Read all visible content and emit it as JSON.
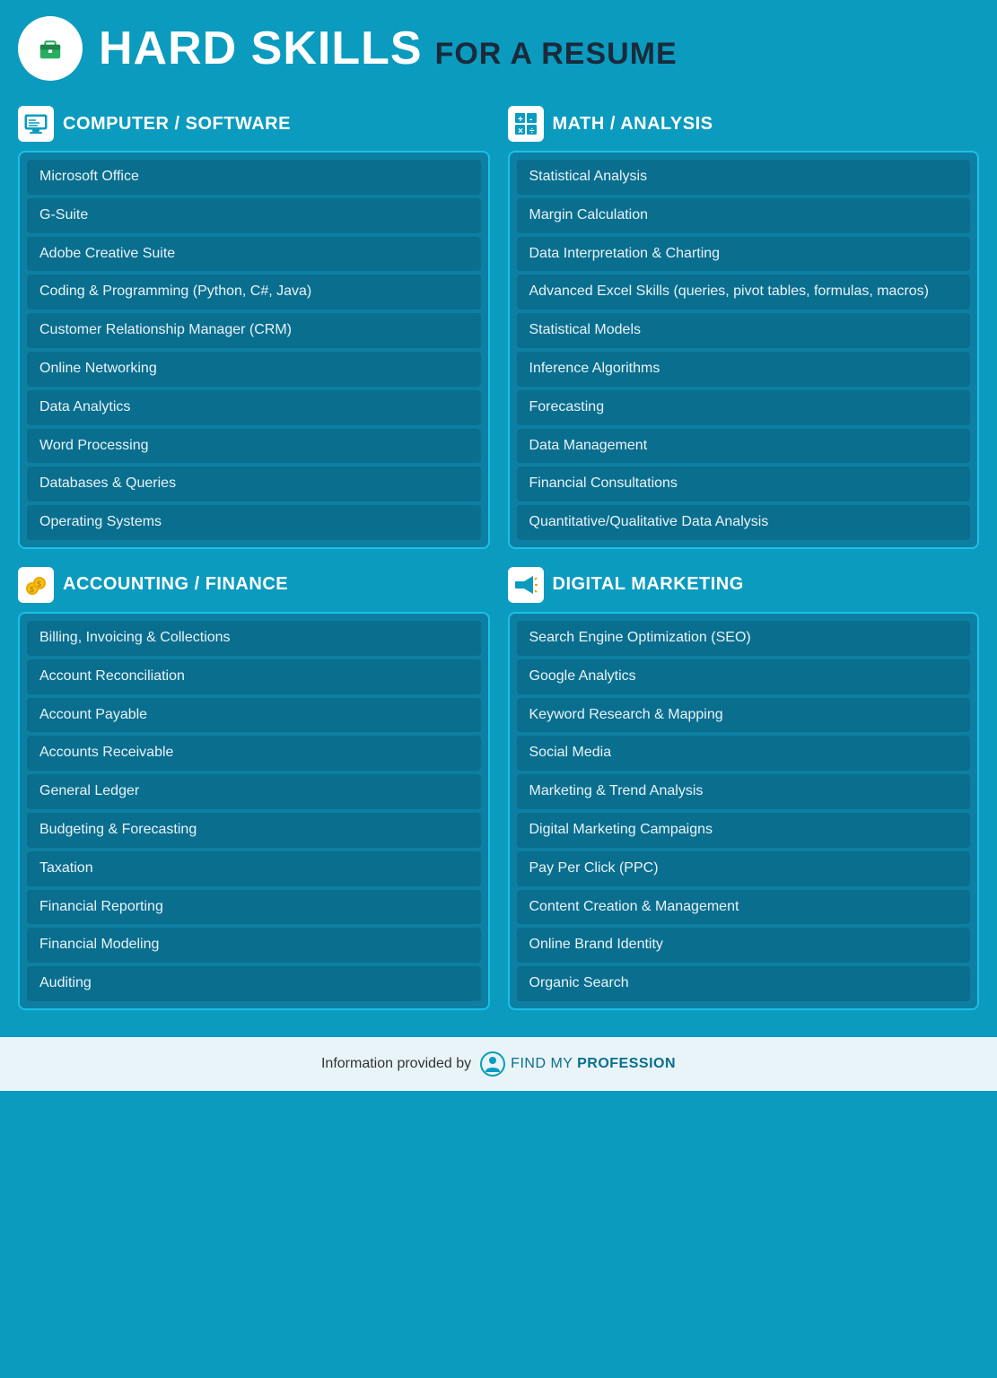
{
  "header": {
    "title_main": "HARD SKILLS",
    "title_sub": "FOR A RESUME",
    "icon_label": "briefcase"
  },
  "sections": [
    {
      "id": "computer-software",
      "title": "COMPUTER / SOFTWARE",
      "icon": "computer",
      "skills": [
        "Microsoft Office",
        "G-Suite",
        "Adobe Creative Suite",
        "Coding & Programming\n(Python, C#, Java)",
        "Customer Relationship Manager\n(CRM)",
        "Online Networking",
        "Data Analytics",
        "Word Processing",
        "Databases & Queries",
        "Operating Systems"
      ]
    },
    {
      "id": "math-analysis",
      "title": "MATH / ANALYSIS",
      "icon": "math",
      "skills": [
        "Statistical Analysis",
        "Margin Calculation",
        "Data Interpretation & Charting",
        "Advanced Excel Skills (queries,\npivot tables, formulas, macros)",
        "Statistical Models",
        "Inference Algorithms",
        "Forecasting",
        "Data Management",
        "Financial Consultations",
        "Quantitative/Qualitative Data\nAnalysis"
      ]
    },
    {
      "id": "accounting-finance",
      "title": "ACCOUNTING / FINANCE",
      "icon": "coins",
      "skills": [
        "Billing, Invoicing & Collections",
        "Account Reconciliation",
        "Account Payable",
        "Accounts Receivable",
        "General Ledger",
        "Budgeting & Forecasting",
        "Taxation",
        "Financial Reporting",
        "Financial Modeling",
        "Auditing"
      ]
    },
    {
      "id": "digital-marketing",
      "title": "DIGITAL MARKETING",
      "icon": "megaphone",
      "skills": [
        "Search Engine Optimization (SEO)",
        "Google Analytics",
        "Keyword Research & Mapping",
        "Social Media",
        "Marketing & Trend Analysis",
        "Digital Marketing Campaigns",
        "Pay Per Click (PPC)",
        "Content Creation & Management",
        "Online Brand Identity",
        "Organic Search"
      ]
    }
  ],
  "footer": {
    "text": "Information provided by",
    "brand_regular": "FIND MY",
    "brand_bold": "PROFESSION"
  }
}
